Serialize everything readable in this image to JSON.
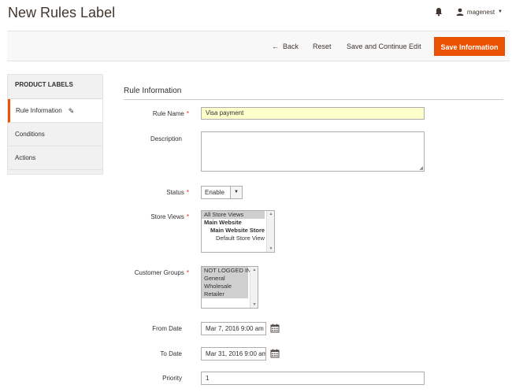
{
  "header": {
    "title": "New Rules Label",
    "username": "magenest"
  },
  "actions": {
    "back": "Back",
    "reset": "Reset",
    "save_continue": "Save and Continue Edit",
    "save": "Save Information"
  },
  "sidebar": {
    "title": "PRODUCT LABELS",
    "items": [
      {
        "label": "Rule Information"
      },
      {
        "label": "Conditions"
      },
      {
        "label": "Actions"
      }
    ]
  },
  "form": {
    "section_title": "Rule Information",
    "rule_name": {
      "label": "Rule Name",
      "value": "Visa payment"
    },
    "description": {
      "label": "Description",
      "value": ""
    },
    "status": {
      "label": "Status",
      "value": "Enable"
    },
    "store_views": {
      "label": "Store Views",
      "options": [
        "All Store Views",
        "Main Website",
        "Main Website Store",
        "Default Store View"
      ]
    },
    "customer_groups": {
      "label": "Customer Groups",
      "options": [
        "NOT LOGGED IN",
        "General",
        "Wholesale",
        "Retailer"
      ]
    },
    "from_date": {
      "label": "From Date",
      "value": "Mar 7, 2016 9:00 am"
    },
    "to_date": {
      "label": "To Date",
      "value": "Mar 31, 2016 9:00 am"
    },
    "priority": {
      "label": "Priority",
      "value": "1"
    }
  },
  "colors": {
    "accent": "#eb5202",
    "required": "#e22626",
    "highlight_input": "#ffffcc"
  }
}
